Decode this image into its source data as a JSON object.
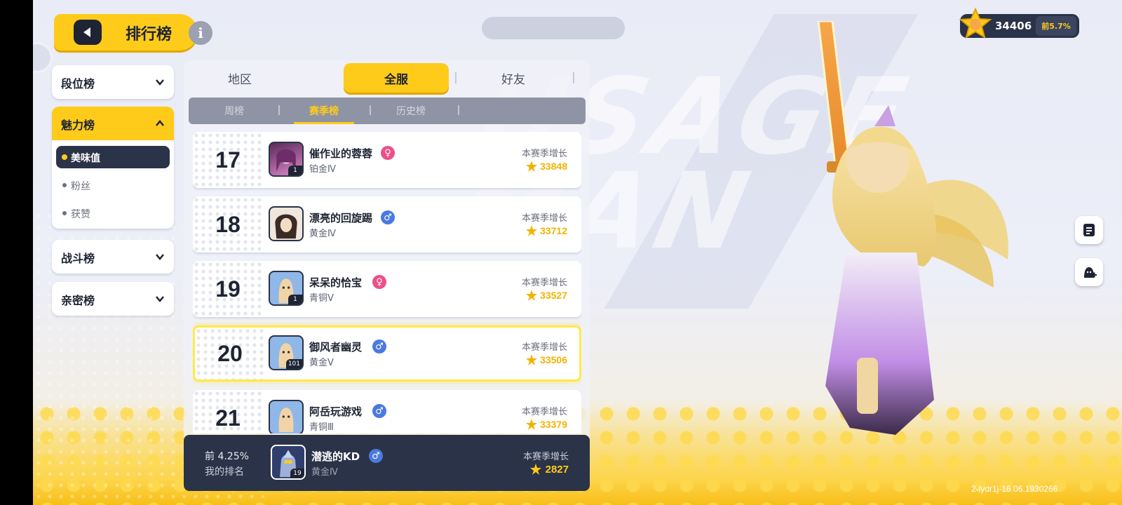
{
  "header": {
    "title": "排行榜",
    "top_center_text_1": "",
    "top_center_text_2": ""
  },
  "score": {
    "value": "34406",
    "rank": "前5.7%"
  },
  "sidebar": {
    "items": [
      {
        "label": "段位榜"
      },
      {
        "label": "魅力榜"
      },
      {
        "label": "战斗榜"
      },
      {
        "label": "亲密榜"
      }
    ],
    "sub_items": [
      {
        "label": "美味值"
      },
      {
        "label": "粉丝"
      },
      {
        "label": "获赞"
      }
    ]
  },
  "tabs": {
    "top": [
      {
        "label": "地区"
      },
      {
        "label": "全服"
      },
      {
        "label": "好友"
      }
    ],
    "sub": [
      {
        "label": "周榜"
      },
      {
        "label": "赛季榜"
      },
      {
        "label": "历史榜"
      }
    ]
  },
  "growth_label": "本赛季增长",
  "rows": [
    {
      "rank": "17",
      "name": "催作业的蓉蓉",
      "gender": "♀",
      "tier": "铂金Ⅳ",
      "value": "33848",
      "level": "1"
    },
    {
      "rank": "18",
      "name": "漂亮的回旋踢",
      "gender": "♂",
      "tier": "黄金Ⅳ",
      "value": "33712",
      "level": ""
    },
    {
      "rank": "19",
      "name": "呆呆的恰宝",
      "gender": "♀",
      "tier": "青铜Ⅴ",
      "value": "33527",
      "level": "1"
    },
    {
      "rank": "20",
      "name": "御风者幽灵",
      "gender": "♂",
      "tier": "黄金Ⅴ",
      "value": "33506",
      "level": "101"
    },
    {
      "rank": "21",
      "name": "阿岳玩游戏",
      "gender": "♂",
      "tier": "青铜Ⅲ",
      "value": "33379",
      "level": ""
    }
  ],
  "my_rank": {
    "percent": "前 4.25%",
    "label": "我的排名",
    "name": "潜逃的KD",
    "gender": "♂",
    "tier": "黄金Ⅳ",
    "value": "2827",
    "level": "19"
  },
  "version": "2-lydr1j-16.06.1930266",
  "colors": {
    "accent": "#ffcb1a",
    "dark": "#2b3348",
    "female": "#ec4f8a",
    "male": "#4a79e0"
  }
}
